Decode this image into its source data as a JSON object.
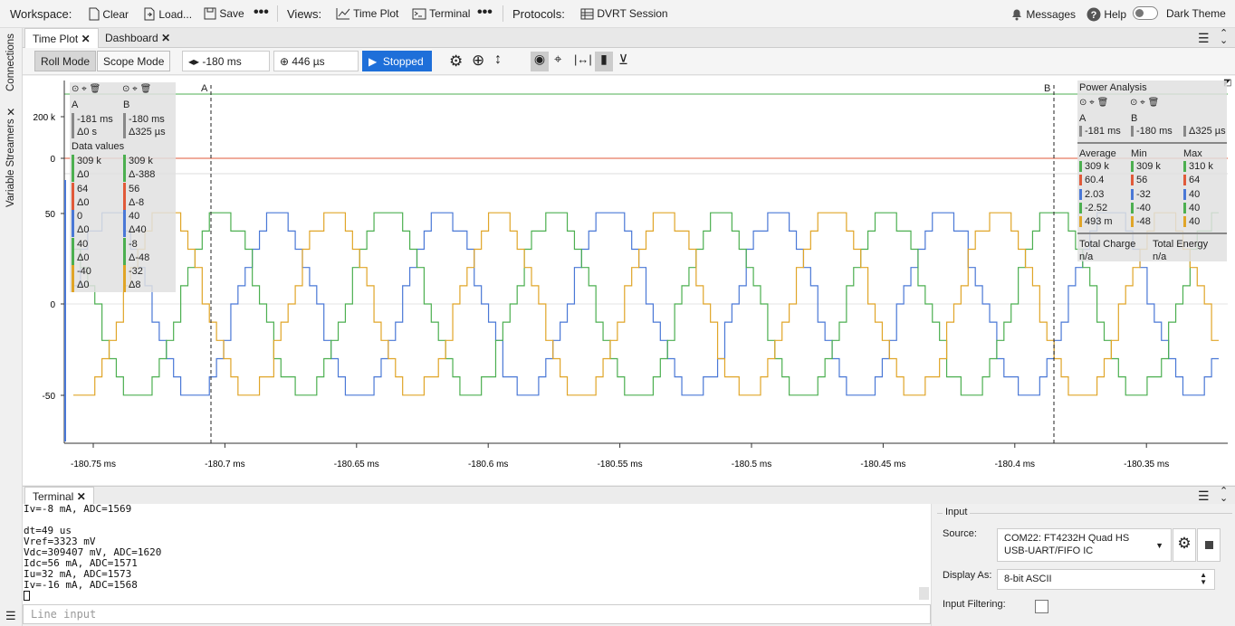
{
  "topbar": {
    "workspace": "Workspace:",
    "clear": "Clear",
    "load": "Load...",
    "save": "Save",
    "views": "Views:",
    "time_plot": "Time Plot",
    "terminal": "Terminal",
    "protocols": "Protocols:",
    "dvrt": "DVRT Session",
    "messages": "Messages",
    "help": "Help",
    "dark_theme": "Dark Theme",
    "dark_theme_on": false
  },
  "sidebar": {
    "connections": "Connections",
    "variable_streamers": "Variable Streamers"
  },
  "tabs": [
    {
      "label": "Time Plot"
    },
    {
      "label": "Dashboard"
    }
  ],
  "toolbar": {
    "roll_mode": "Roll Mode",
    "scope_mode": "Scope Mode",
    "time_offset": "-180 ms",
    "time_scale": "446 µs",
    "run_state": "Stopped"
  },
  "colors": {
    "green": "#4caf50",
    "red": "#e05a3a",
    "blue": "#4a78d6",
    "orange": "#e0a528",
    "accent": "#1e6fd9"
  },
  "plot": {
    "cursor_a_label": "A",
    "cursor_b_label": "B",
    "y_ticks_top": [
      "200 k",
      "0"
    ],
    "y_ticks_bottom": [
      "50",
      "0",
      "-50"
    ],
    "x_ticks": [
      "-180.75 ms",
      "-180.7 ms",
      "-180.65 ms",
      "-180.6 ms",
      "-180.55 ms",
      "-180.5 ms",
      "-180.45 ms",
      "-180.4 ms",
      "-180.35 ms"
    ]
  },
  "cursor_panel": {
    "a": {
      "label": "A",
      "time": "-181 ms",
      "delta": "Δ0 s"
    },
    "b": {
      "label": "B",
      "time": "-180 ms",
      "delta": "Δ325 µs"
    },
    "data_values_label": "Data values",
    "rows": [
      {
        "a": "309 k",
        "ad": "Δ0",
        "b": "309 k",
        "bd": "Δ-388",
        "color": "#4caf50"
      },
      {
        "a": "64",
        "ad": "Δ0",
        "b": "56",
        "bd": "Δ-8",
        "color": "#e05a3a"
      },
      {
        "a": "0",
        "ad": "Δ0",
        "b": "40",
        "bd": "Δ40",
        "color": "#4a78d6"
      },
      {
        "a": "40",
        "ad": "Δ0",
        "b": "-8",
        "bd": "Δ-48",
        "color": "#4caf50"
      },
      {
        "a": "-40",
        "ad": "Δ0",
        "b": "-32",
        "bd": "Δ8",
        "color": "#e0a528"
      }
    ]
  },
  "power": {
    "title": "Power Analysis",
    "a": {
      "label": "A",
      "time": "-181 ms"
    },
    "b": {
      "label": "B",
      "time": "-180 ms",
      "delta": "Δ325 µs"
    },
    "headers": [
      "Average",
      "Min",
      "Max"
    ],
    "rows": [
      {
        "avg": "309 k",
        "min": "309 k",
        "max": "310 k",
        "color": "#4caf50"
      },
      {
        "avg": "60.4",
        "min": "56",
        "max": "64",
        "color": "#e05a3a"
      },
      {
        "avg": "2.03",
        "min": "-32",
        "max": "40",
        "color": "#4a78d6"
      },
      {
        "avg": "-2.52",
        "min": "-40",
        "max": "40",
        "color": "#4caf50"
      },
      {
        "avg": "493 m",
        "min": "-48",
        "max": "40",
        "color": "#e0a528"
      }
    ],
    "total_charge_label": "Total Charge",
    "total_charge": "n/a",
    "total_energy_label": "Total Energy",
    "total_energy": "n/a"
  },
  "terminal": {
    "tab": "Terminal",
    "lines": [
      "Iv=-8 mA, ADC=1569",
      "",
      "dt=49 us",
      "Vref=3323 mV",
      "Vdc=309407 mV, ADC=1620",
      "Idc=56 mA, ADC=1571",
      "Iu=32 mA, ADC=1573",
      "Iv=-16 mA, ADC=1568"
    ],
    "line_input_placeholder": "Line input"
  },
  "input_panel": {
    "title": "Input",
    "source_label": "Source:",
    "source_line1": "COM22: FT4232H Quad HS",
    "source_line2": "USB-UART/FIFO IC",
    "display_as_label": "Display As:",
    "display_as": "8-bit ASCII",
    "filtering_label": "Input Filtering:",
    "filtering_on": false
  }
}
